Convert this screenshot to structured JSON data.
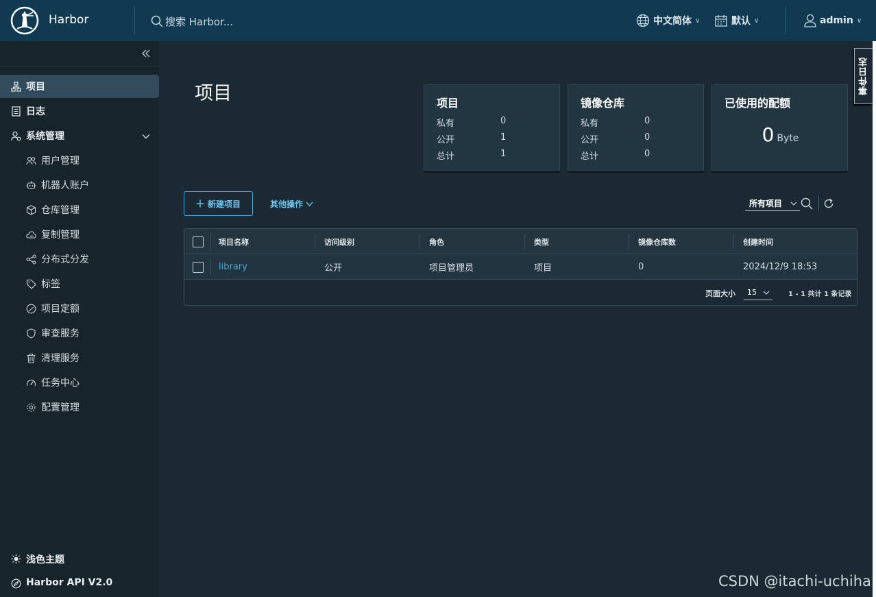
{
  "header": {
    "brand": "Harbor",
    "search_placeholder": "搜索 Harbor...",
    "language": "中文简体",
    "theme_select": "默认",
    "user": "admin"
  },
  "sidebar": {
    "items": [
      {
        "label": "项目",
        "icon": "projects-icon",
        "active": true
      },
      {
        "label": "日志",
        "icon": "logs-icon"
      },
      {
        "label": "系统管理",
        "icon": "system-admin-icon",
        "expandable": true
      }
    ],
    "sub_items": [
      {
        "label": "用户管理",
        "icon": "users-icon"
      },
      {
        "label": "机器人账户",
        "icon": "robot-icon"
      },
      {
        "label": "仓库管理",
        "icon": "box-icon"
      },
      {
        "label": "复制管理",
        "icon": "cloud-sync-icon"
      },
      {
        "label": "分布式分发",
        "icon": "share-icon"
      },
      {
        "label": "标签",
        "icon": "tag-icon"
      },
      {
        "label": "项目定额",
        "icon": "gauge-icon"
      },
      {
        "label": "审查服务",
        "icon": "shield-icon"
      },
      {
        "label": "清理服务",
        "icon": "trash-icon"
      },
      {
        "label": "任务中心",
        "icon": "dashboard-icon"
      },
      {
        "label": "配置管理",
        "icon": "gear-icon"
      }
    ],
    "bottom": {
      "theme_toggle": "浅色主题",
      "api": "Harbor API V2.0"
    }
  },
  "main": {
    "title": "项目",
    "cards": {
      "projects": {
        "title": "项目",
        "rows": [
          {
            "label": "私有",
            "value": "0"
          },
          {
            "label": "公开",
            "value": "1"
          },
          {
            "label": "总计",
            "value": "1"
          }
        ]
      },
      "repositories": {
        "title": "镜像仓库",
        "rows": [
          {
            "label": "私有",
            "value": "0"
          },
          {
            "label": "公开",
            "value": "0"
          },
          {
            "label": "总计",
            "value": "0"
          }
        ]
      },
      "quota": {
        "title": "已使用的配额",
        "value": "0",
        "unit": "Byte"
      }
    },
    "toolbar": {
      "new_project": "新建项目",
      "more_actions": "其他操作",
      "filter": "所有项目"
    },
    "table": {
      "columns": [
        "项目名称",
        "访问级别",
        "角色",
        "类型",
        "镜像仓库数",
        "创建时间"
      ],
      "rows": [
        [
          "library",
          "公开",
          "项目管理员",
          "项目",
          "0",
          "2024/12/9 18:53"
        ]
      ],
      "footer": {
        "page_size_label": "页面大小",
        "page_size": "15",
        "total": "1 - 1 共计 1 条记录"
      }
    }
  },
  "event_log_tab": "事件日志",
  "watermark": "CSDN @itachi-uchiha",
  "colors": {
    "header_bg": "#0f3a52",
    "sidebar_bg": "#17242b",
    "main_bg": "#1b2a32",
    "accent": "#4aa6d6"
  }
}
